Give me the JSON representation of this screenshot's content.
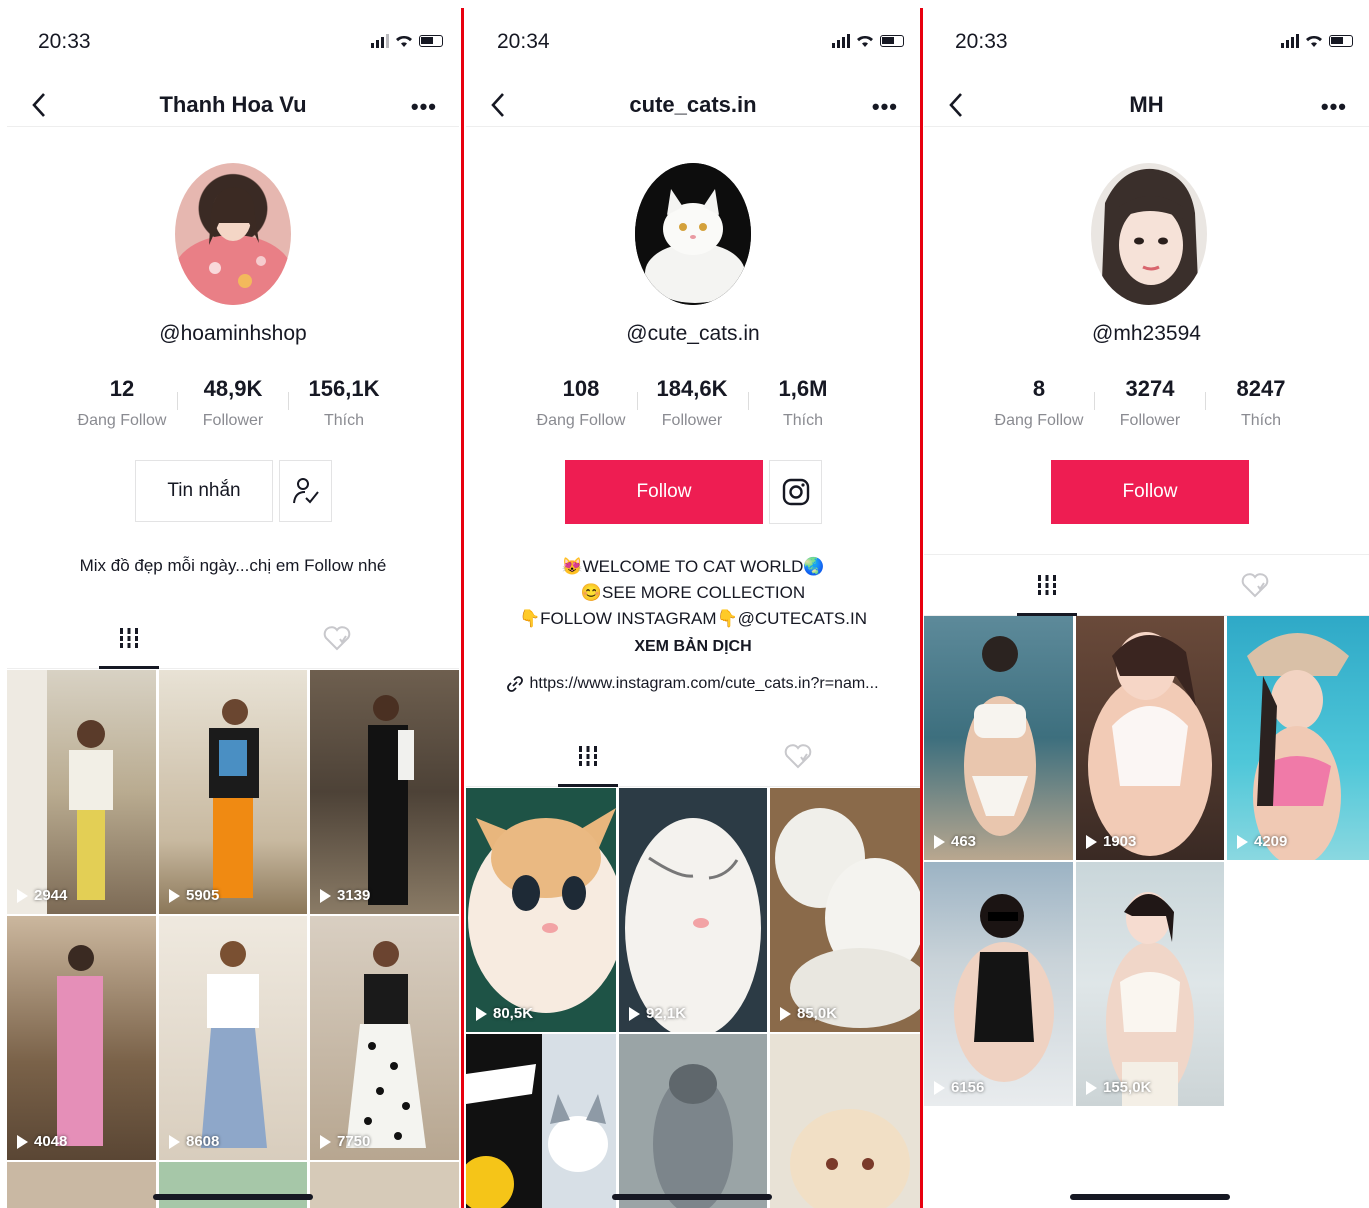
{
  "panels": [
    {
      "time": "20:33",
      "title": "Thanh Hoa Vu",
      "handle": "@hoaminhshop",
      "stats": [
        {
          "num": "12",
          "label": "Đang Follow"
        },
        {
          "num": "48,9K",
          "label": "Follower"
        },
        {
          "num": "156,1K",
          "label": "Thích"
        }
      ],
      "message_button": "Tin nhắn",
      "bio": "Mix đồ đẹp mỗi ngày...chị em Follow nhé",
      "videos": [
        "2944",
        "5905",
        "3139",
        "4048",
        "8608",
        "7750"
      ]
    },
    {
      "time": "20:34",
      "title": "cute_cats.in",
      "handle": "@cute_cats.in",
      "stats": [
        {
          "num": "108",
          "label": "Đang Follow"
        },
        {
          "num": "184,6K",
          "label": "Follower"
        },
        {
          "num": "1,6M",
          "label": "Thích"
        }
      ],
      "follow_button": "Follow",
      "bio_lines": [
        "😻WELCOME TO CAT WORLD🌏",
        "😊SEE MORE COLLECTION",
        "👇FOLLOW INSTAGRAM👇@CUTECATS.IN"
      ],
      "translate": "XEM BẢN DỊCH",
      "link": "https://www.instagram.com/cute_cats.in?r=nam...",
      "videos": [
        "80,5K",
        "92,1K",
        "85,0K"
      ]
    },
    {
      "time": "20:33",
      "title": "MH",
      "handle": "@mh23594",
      "stats": [
        {
          "num": "8",
          "label": "Đang Follow"
        },
        {
          "num": "3274",
          "label": "Follower"
        },
        {
          "num": "8247",
          "label": "Thích"
        }
      ],
      "follow_button": "Follow",
      "videos": [
        "463",
        "1903",
        "4209",
        "6156",
        "155,0K"
      ]
    }
  ],
  "colors": {
    "accent": "#ee1d52",
    "divider": "#e8000f"
  }
}
